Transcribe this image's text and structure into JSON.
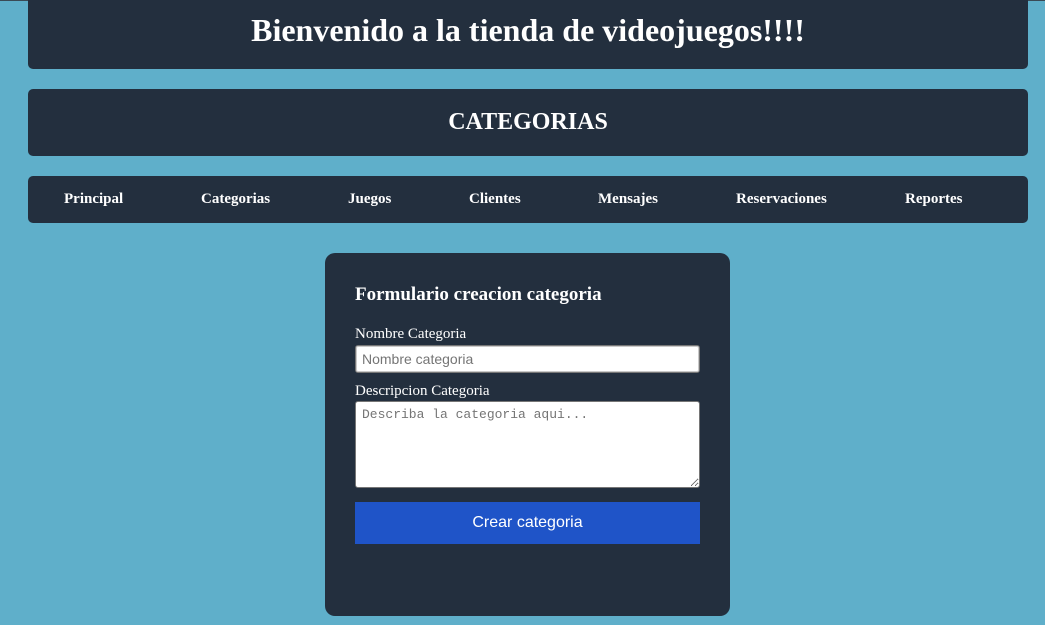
{
  "header": {
    "title": "Bienvenido a la tienda de videojuegos!!!!"
  },
  "section": {
    "title": "CATEGORIAS"
  },
  "nav": {
    "items": [
      {
        "label": "Principal"
      },
      {
        "label": "Categorias"
      },
      {
        "label": "Juegos"
      },
      {
        "label": "Clientes"
      },
      {
        "label": "Mensajes"
      },
      {
        "label": "Reservaciones"
      },
      {
        "label": "Reportes"
      }
    ]
  },
  "form": {
    "title": "Formulario creacion categoria",
    "name_label": "Nombre Categoria",
    "name_value": "",
    "name_placeholder": "Nombre categoria",
    "description_label": "Descripcion Categoria",
    "description_value": "",
    "description_placeholder": "Describa la categoria aqui...",
    "submit_label": "Crear categoria"
  },
  "colors": {
    "background": "#5fafca",
    "panel": "#232f3e",
    "button": "#1f54c8",
    "text": "#ffffff"
  }
}
